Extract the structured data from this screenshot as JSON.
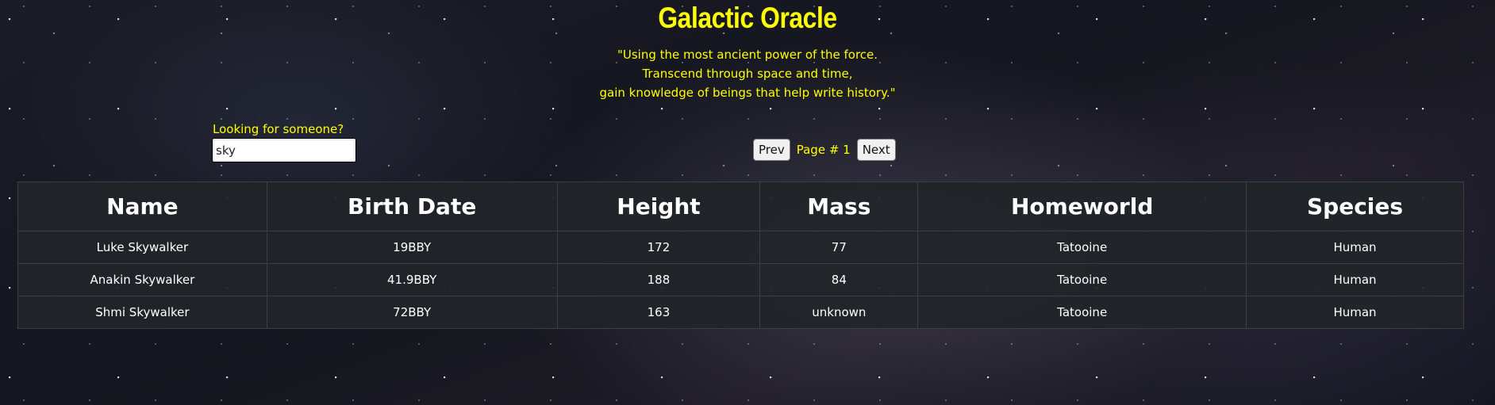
{
  "header": {
    "title": "Galactic Oracle",
    "quote_lines": [
      "\"Using the most ancient power of the force.",
      "Transcend through space and time,",
      "gain knowledge of beings that help write history.\""
    ]
  },
  "search": {
    "label": "Looking for someone?",
    "value": "sky"
  },
  "pagination": {
    "prev_label": "Prev",
    "page_label": "Page # 1",
    "next_label": "Next"
  },
  "table": {
    "columns": [
      "Name",
      "Birth Date",
      "Height",
      "Mass",
      "Homeworld",
      "Species"
    ],
    "rows": [
      [
        "Luke Skywalker",
        "19BBY",
        "172",
        "77",
        "Tatooine",
        "Human"
      ],
      [
        "Anakin Skywalker",
        "41.9BBY",
        "188",
        "84",
        "Tatooine",
        "Human"
      ],
      [
        "Shmi Skywalker",
        "72BBY",
        "163",
        "unknown",
        "Tatooine",
        "Human"
      ]
    ]
  },
  "colors": {
    "accent_text": "#ffff00",
    "table_bg": "#212529",
    "table_border": "#3b3f45"
  }
}
